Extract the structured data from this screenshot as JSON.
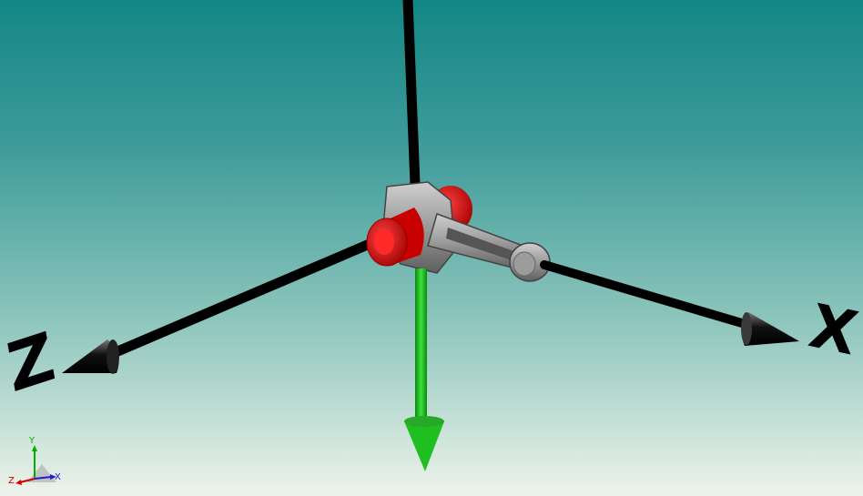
{
  "view": {
    "colors": {
      "background_top": "#138786",
      "background_bottom": "#eef3ea",
      "axis": "#000000",
      "gravity_arrow": "#1fbf1f",
      "joint_cylinder": "#e00000",
      "part_metal": "#8a8a8a"
    }
  },
  "axes": {
    "z_label": "Z",
    "x_label": "X"
  },
  "triad": {
    "y_label": "Y",
    "z_label": "Z",
    "x_label": "X",
    "colors": {
      "y": "#00b000",
      "z": "#d00000",
      "x": "#2020d0"
    }
  }
}
